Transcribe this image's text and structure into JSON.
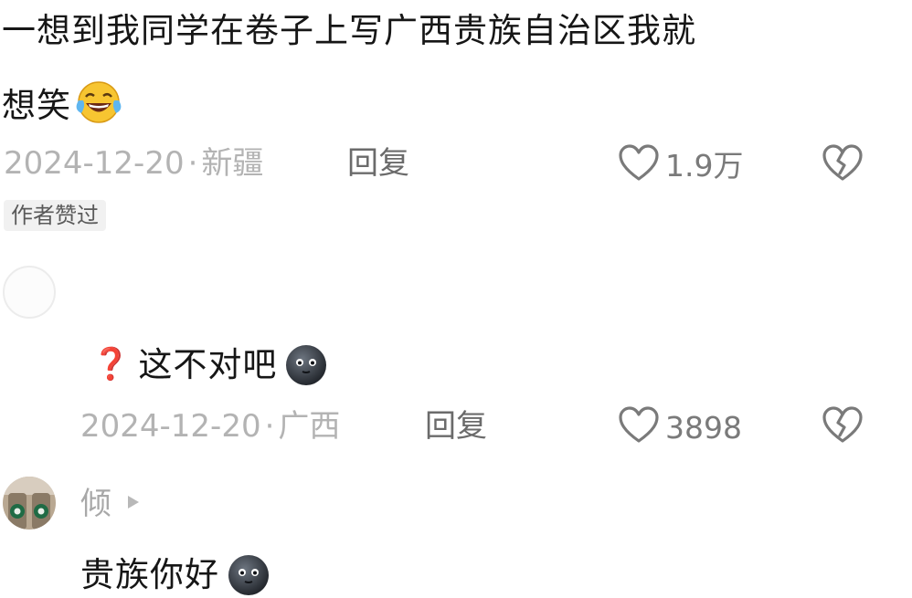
{
  "comment1": {
    "text_line1": "一想到我同学在卷子上写广西贵族自治区我就",
    "text_line2": "想笑",
    "laugh_emoji": "😂",
    "date": "2024-12-20",
    "location": "新疆",
    "reply_label": "回复",
    "like_count": "1.9万",
    "author_badge": "作者赞过"
  },
  "reply1": {
    "question_mark": "❓",
    "text": "这不对吧",
    "date": "2024-12-20",
    "location": "广西",
    "reply_label": "回复",
    "like_count": "3898"
  },
  "reply2": {
    "username": "倾",
    "text": "贵族你好"
  },
  "separator": "·",
  "colors": {
    "primary_text": "#161616",
    "meta_text": "#b3b3b3",
    "reply_text": "#6b6b6b",
    "badge_bg": "#f1f1f1",
    "question_red": "#e0322c"
  },
  "icons": [
    "heart-outline-icon",
    "broken-heart-icon",
    "laughing-emoji-icon",
    "dark-face-emoji-icon",
    "play-arrow-icon"
  ]
}
